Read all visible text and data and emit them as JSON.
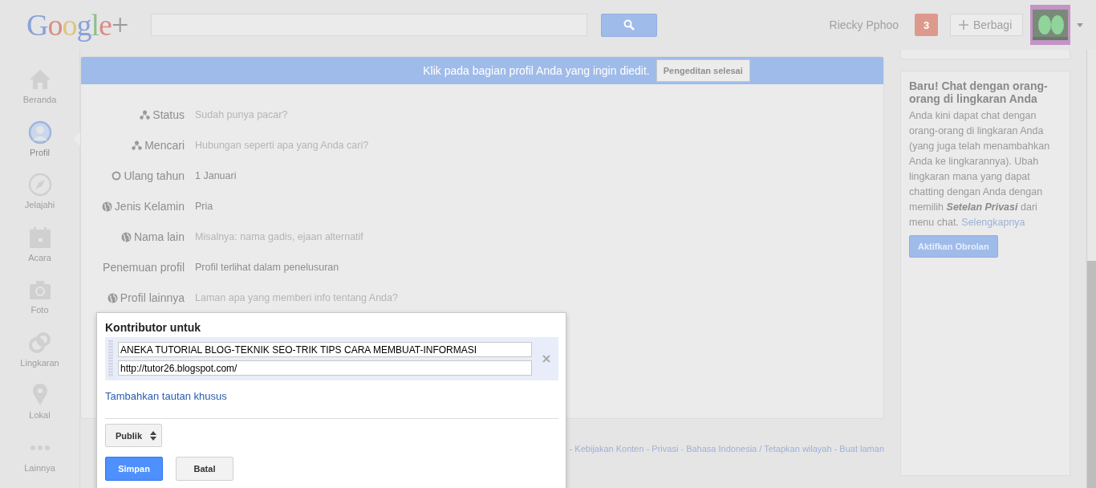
{
  "header": {
    "logo": "Google+",
    "user_name": "Riecky Pphoo",
    "notifications": "3",
    "share_button": "Berbagi",
    "search_button": {
      "kind": "search"
    }
  },
  "nav": [
    {
      "label": "Beranda",
      "selected": false
    },
    {
      "label": "Profil",
      "selected": true
    },
    {
      "label": "Jelajahi",
      "selected": false
    },
    {
      "label": "Acara",
      "selected": false
    },
    {
      "label": "Foto",
      "selected": false
    },
    {
      "label": "Lingkaran",
      "selected": false
    },
    {
      "label": "Lokal",
      "selected": false
    },
    {
      "label": "Lainnya",
      "selected": false
    }
  ],
  "banner": {
    "message": "Klik pada bagian profil Anda yang ingin diedit.",
    "button": "Pengeditan selesai"
  },
  "profile_fields": [
    {
      "label": "Status",
      "value": "Sudah punya pacar?",
      "kind": "hint"
    },
    {
      "label": "Mencari",
      "value": "Hubungan seperti apa yang Anda cari?",
      "kind": "hint"
    },
    {
      "label": "Ulang tahun",
      "value": "1 Januari",
      "kind": "value"
    },
    {
      "label": "Jenis Kelamin",
      "value": "Pria",
      "kind": "value"
    },
    {
      "label": "Nama lain",
      "value": "Misalnya: nama gadis, ejaan alternatif",
      "kind": "hint"
    },
    {
      "label": "Penemuan profil",
      "value": "Profil terlihat dalam penelusuran",
      "kind": "value"
    },
    {
      "label": "Profil lainnya",
      "value": "Laman apa yang memberi info tentang Anda?",
      "kind": "hint"
    }
  ],
  "dialog": {
    "title": "Kontributor untuk",
    "links": [
      {
        "title": "ANEKA TUTORIAL BLOG-TEKNIK SEO-TRIK TIPS CARA MEMBUAT-INFORMASI",
        "url": "http://tutor26.blogspot.com/"
      }
    ],
    "add_link": "Tambahkan tautan khusus",
    "visibility": "Publik",
    "save": "Simpan",
    "cancel": "Batal"
  },
  "footer": "- Kebijakan Konten - Privasi - Bahasa Indonesia / Tetapkan wilayah - Buat laman",
  "chat_card": {
    "title": "Baru! Chat dengan orang-orang di lingkaran Anda",
    "body": "Anda kini dapat chat dengan orang-orang di lingkaran Anda (yang juga telah menambahkan Anda ke lingkarannya). Ubah lingkaran mana yang dapat chatting dengan Anda dengan memilih **Setelan Privasi** dari menu chat.",
    "more_link": "Selengkapnya",
    "button": "Aktifkan Obrolan"
  }
}
